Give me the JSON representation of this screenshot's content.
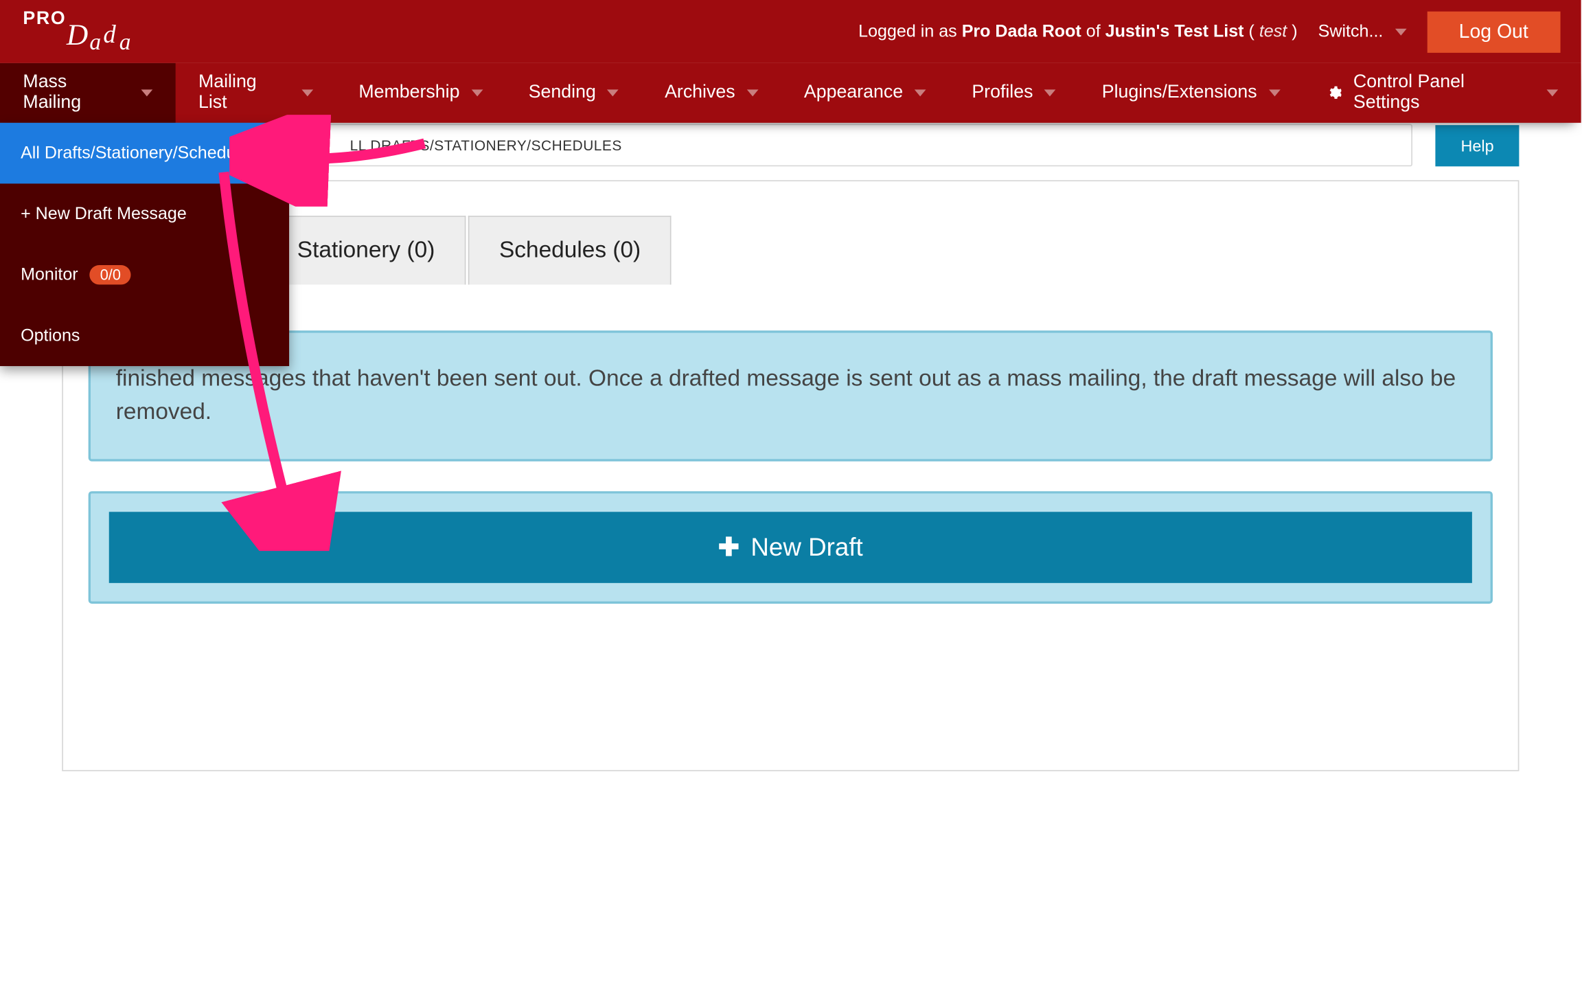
{
  "brand": {
    "pro": "PRO",
    "dada": "Dada"
  },
  "topbar": {
    "logged_in_prefix": "Logged in as ",
    "root_name": "Pro Dada Root",
    "of_word": " of ",
    "list_name": "Justin's Test List",
    "list_code_open": " ( ",
    "list_code": "test",
    "list_code_close": " )",
    "switch_label": "Switch...",
    "logout_label": "Log Out"
  },
  "nav": {
    "mass_mailing": "Mass Mailing",
    "mailing_list": "Mailing List",
    "membership": "Membership",
    "sending": "Sending",
    "archives": "Archives",
    "appearance": "Appearance",
    "profiles": "Profiles",
    "plugins": "Plugins/Extensions",
    "cp_settings": "Control Panel Settings"
  },
  "dropdown": {
    "all": "All Drafts/Stationery/Schedules",
    "new_draft": "+ New Draft Message",
    "monitor": "Monitor",
    "monitor_badge": "0/0",
    "options": "Options"
  },
  "breadcrumb": {
    "text": "LL DRAFTS/STATIONERY/SCHEDULES"
  },
  "help_label": "Help",
  "tabs": {
    "stationery": "Stationery (0)",
    "schedules": "Schedules (0)"
  },
  "info_text": "finished messages that haven't been sent out. Once a drafted message is sent out as a mass mailing, the draft message will also be removed.",
  "new_draft_btn": "New Draft",
  "colors": {
    "brand_red": "#9e0b0f",
    "accent_blue": "#1d7be0",
    "teal": "#0b7ea4",
    "info_bg": "#b8e2ef"
  }
}
